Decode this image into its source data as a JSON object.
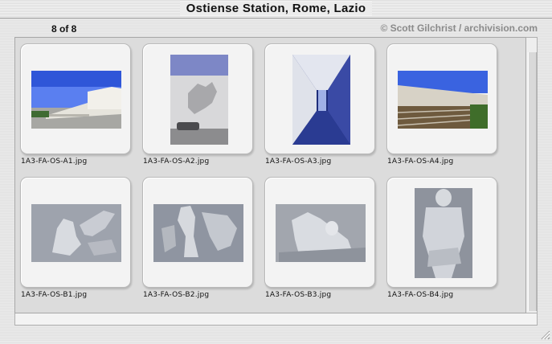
{
  "window": {
    "title": "Ostiense Station, Rome, Lazio"
  },
  "header": {
    "count": "8 of 8",
    "copyright": "© Scott Gilchrist / archivision.com"
  },
  "images": [
    {
      "filename": "1A3-FA-OS-A1.jpg",
      "subject": "station exterior blue sky"
    },
    {
      "filename": "1A3-FA-OS-A2.jpg",
      "subject": "facade relief with car"
    },
    {
      "filename": "1A3-FA-OS-A3.jpg",
      "subject": "colonnade corridor"
    },
    {
      "filename": "1A3-FA-OS-A4.jpg",
      "subject": "platform and tracks"
    },
    {
      "filename": "1A3-FA-OS-B1.jpg",
      "subject": "relief archer horse"
    },
    {
      "filename": "1A3-FA-OS-B2.jpg",
      "subject": "relief figure with horse"
    },
    {
      "filename": "1A3-FA-OS-B3.jpg",
      "subject": "relief reclining figure"
    },
    {
      "filename": "1A3-FA-OS-B4.jpg",
      "subject": "relief torso statue"
    }
  ]
}
